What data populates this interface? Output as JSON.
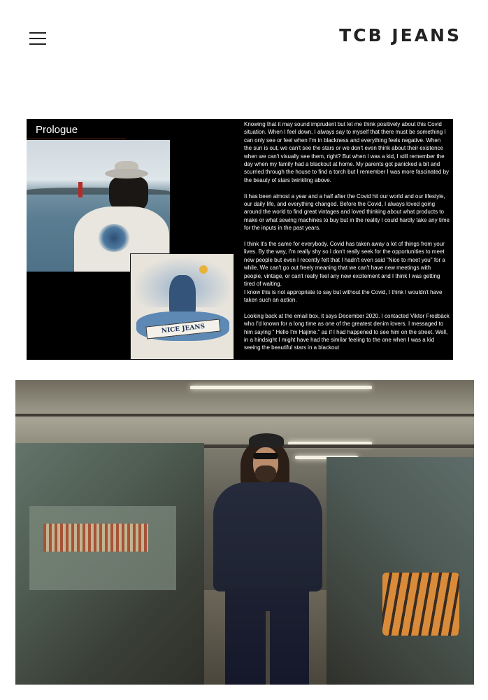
{
  "header": {
    "brand": "TCB JEANS",
    "menu_icon": "hamburger-menu-icon"
  },
  "prologue": {
    "title": "Prologue",
    "print_banner": "NICE JEANS",
    "paragraphs": [
      "Knowing that it may sound imprudent but let me think positively about this Covid situation. When I feel down, I always say to myself that there must be something I can only see or feel when I'm in blackness and everything feels negative. When the sun is out, we can't see the stars or we don't even think about their existence when we can't visually see them, right? But when I was a kid, I still remember the day when my family had a blackout at home. My parents got panicked a bit and scurried through the house to find a torch but I remember I was more fascinated by the beauty of stars twinkling above.",
      "It has been almost a year and a half after the Covid hit our world and our lifestyle, our daily life, and everything changed. Before the Covid, I always loved going around the world to find great vintages and loved thinking about what products to make or what sewing machines to buy but in the reality I could hardly take any time for the inputs in the past years.",
      "I think it's the same for everybody. Covid has taken away a lot of things from your lives. By the way, I'm really shy so I don't really seek for the opportunities to meet new people but even I recently felt that I hadn't even said \"Nice to meet you\" for a while. We can't go out freely meaning that we can't have new meetings with people, vintage, or can't really feel any new excitement and I think I was getting tired of waiting.",
      "I know this is not appropriate to say but without the Covid, I think I wouldn't have taken such an action.",
      " Looking back at the email box, it says December 2020. I contacted Viktor Fredbäck who I'd known for a long time as one of the greatest denim lovers. I messaged to him saying \" Hello I'm Hajime.\" as if I had happened to see him on the street. Well, in a hindsight I might have had the similar feeling to the one when I was a kid seeing the beautiful stars in a blackout"
    ]
  },
  "colors": {
    "brand_text": "#222222",
    "panel_background": "#000000",
    "panel_text": "#ffffff"
  }
}
